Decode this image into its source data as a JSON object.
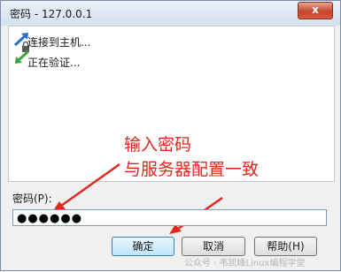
{
  "window": {
    "title": "密码 - 127.0.0.1",
    "close_label": "x"
  },
  "status": {
    "lines": [
      "连接到主机...",
      "正在验证..."
    ]
  },
  "annotation": {
    "line1": "输入密码",
    "line2": "与服务器配置一致"
  },
  "password": {
    "label": "密码(P):",
    "value": "●●●●●●"
  },
  "buttons": {
    "ok": "确定",
    "cancel": "取消",
    "help": "帮助(H)"
  },
  "watermark": "公众号 · 韦凯峰Linux编程学堂",
  "colors": {
    "annotation": "#e0271e",
    "title_bar": "#d6e1ee",
    "close_button": "#c7442d"
  },
  "icons": {
    "connection": "connection-arrows-icon"
  }
}
